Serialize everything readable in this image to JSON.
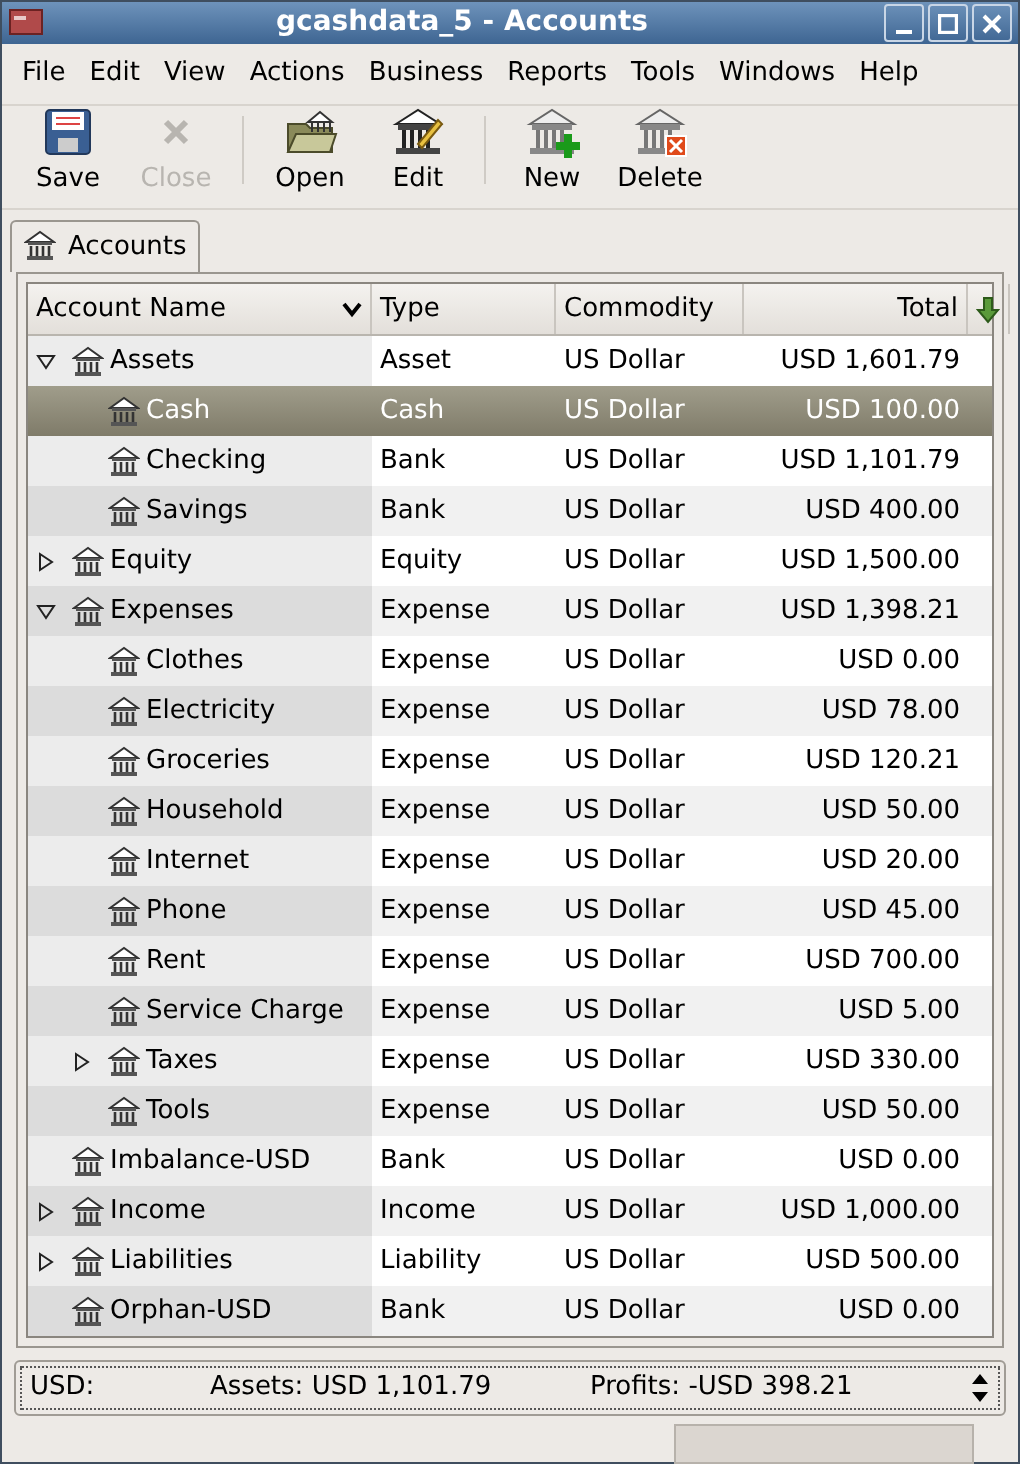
{
  "window": {
    "title": "gcashdata_5 - Accounts"
  },
  "menu": [
    "File",
    "Edit",
    "View",
    "Actions",
    "Business",
    "Reports",
    "Tools",
    "Windows",
    "Help"
  ],
  "toolbar": [
    {
      "label": "Save",
      "kind": "save",
      "disabled": false
    },
    {
      "label": "Close",
      "kind": "close",
      "disabled": true
    },
    {
      "kind": "separator"
    },
    {
      "label": "Open",
      "kind": "open",
      "disabled": false
    },
    {
      "label": "Edit",
      "kind": "edit",
      "disabled": false
    },
    {
      "kind": "separator"
    },
    {
      "label": "New",
      "kind": "new",
      "disabled": false
    },
    {
      "label": "Delete",
      "kind": "delete",
      "disabled": false
    }
  ],
  "tabs": [
    {
      "label": "Accounts",
      "selected": true
    }
  ],
  "table": {
    "columns": [
      "Account Name",
      "Type",
      "Commodity",
      "Total"
    ],
    "accounts": [
      {
        "name": "Assets",
        "type": "Asset",
        "commodity": "US Dollar",
        "total": "USD 1,601.79",
        "selected": false,
        "expanded": true,
        "children": [
          {
            "name": "Cash",
            "type": "Cash",
            "commodity": "US Dollar",
            "total": "USD 100.00",
            "selected": true
          },
          {
            "name": "Checking",
            "type": "Bank",
            "commodity": "US Dollar",
            "total": "USD 1,101.79",
            "selected": false
          },
          {
            "name": "Savings",
            "type": "Bank",
            "commodity": "US Dollar",
            "total": "USD 400.00",
            "selected": false
          }
        ]
      },
      {
        "name": "Equity",
        "type": "Equity",
        "commodity": "US Dollar",
        "total": "USD 1,500.00",
        "selected": false,
        "expanded": false
      },
      {
        "name": "Expenses",
        "type": "Expense",
        "commodity": "US Dollar",
        "total": "USD 1,398.21",
        "selected": false,
        "expanded": true,
        "children": [
          {
            "name": "Clothes",
            "type": "Expense",
            "commodity": "US Dollar",
            "total": "USD 0.00",
            "selected": false
          },
          {
            "name": "Electricity",
            "type": "Expense",
            "commodity": "US Dollar",
            "total": "USD 78.00",
            "selected": false
          },
          {
            "name": "Groceries",
            "type": "Expense",
            "commodity": "US Dollar",
            "total": "USD 120.21",
            "selected": false
          },
          {
            "name": "Household",
            "type": "Expense",
            "commodity": "US Dollar",
            "total": "USD 50.00",
            "selected": false
          },
          {
            "name": "Internet",
            "type": "Expense",
            "commodity": "US Dollar",
            "total": "USD 20.00",
            "selected": false
          },
          {
            "name": "Phone",
            "type": "Expense",
            "commodity": "US Dollar",
            "total": "USD 45.00",
            "selected": false
          },
          {
            "name": "Rent",
            "type": "Expense",
            "commodity": "US Dollar",
            "total": "USD 700.00",
            "selected": false
          },
          {
            "name": "Service Charge",
            "type": "Expense",
            "commodity": "US Dollar",
            "total": "USD 5.00",
            "selected": false
          },
          {
            "name": "Taxes",
            "type": "Expense",
            "commodity": "US Dollar",
            "total": "USD 330.00",
            "selected": false,
            "expanded": false
          },
          {
            "name": "Tools",
            "type": "Expense",
            "commodity": "US Dollar",
            "total": "USD 50.00",
            "selected": false
          }
        ]
      },
      {
        "name": "Imbalance-USD",
        "type": "Bank",
        "commodity": "US Dollar",
        "total": "USD 0.00",
        "selected": false
      },
      {
        "name": "Income",
        "type": "Income",
        "commodity": "US Dollar",
        "total": "USD 1,000.00",
        "selected": false,
        "expanded": false
      },
      {
        "name": "Liabilities",
        "type": "Liability",
        "commodity": "US Dollar",
        "total": "USD 500.00",
        "selected": false,
        "expanded": false
      },
      {
        "name": "Orphan-USD",
        "type": "Bank",
        "commodity": "US Dollar",
        "total": "USD 0.00",
        "selected": false
      }
    ]
  },
  "summary": {
    "currency": "USD:",
    "assets": "Assets: USD 1,101.79",
    "profits": "Profits: -USD 398.21"
  }
}
